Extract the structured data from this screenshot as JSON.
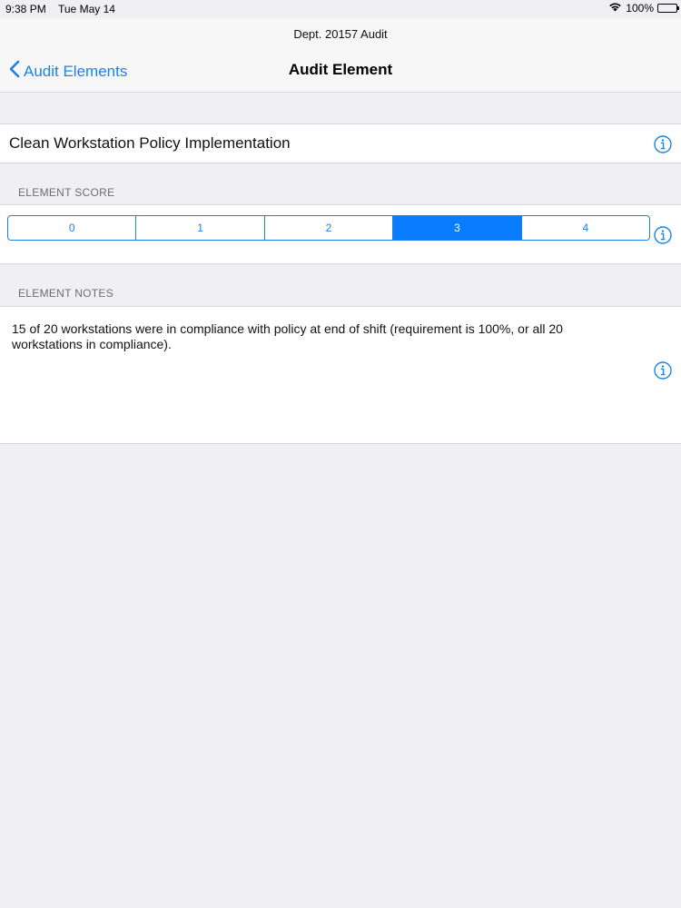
{
  "status_bar": {
    "time": "9:38 PM",
    "date": "Tue May 14",
    "battery": "100%",
    "icons": [
      "wifi-icon",
      "battery-icon"
    ]
  },
  "nav": {
    "context_title": "Dept. 20157 Audit",
    "back_label": "Audit Elements",
    "title": "Audit Element"
  },
  "element": {
    "name": "Clean Workstation Policy Implementation"
  },
  "score": {
    "header": "ELEMENT SCORE",
    "options": [
      "0",
      "1",
      "2",
      "3",
      "4"
    ],
    "selected": "3"
  },
  "notes": {
    "header": "ELEMENT NOTES",
    "text": "15 of 20 workstations were in compliance with policy at end of shift (requirement is 100%, or all 20 workstations in compliance)."
  },
  "colors": {
    "accent": "#1a82e8",
    "selected_segment": "#0a7cff",
    "background": "#efeff4"
  }
}
